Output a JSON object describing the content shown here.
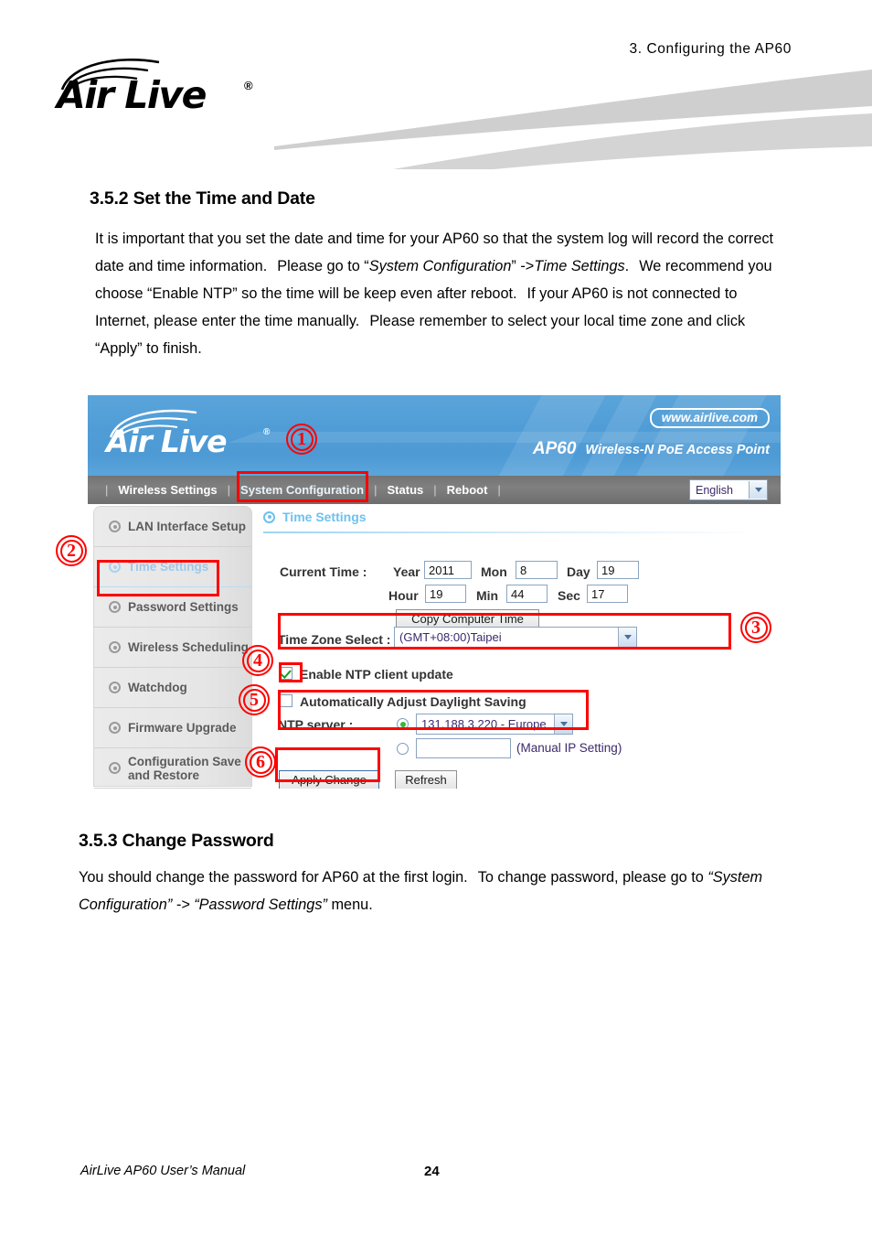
{
  "page": {
    "chapter_header": "3.  Configuring  the  AP60",
    "footer_text": "AirLive AP60 User’s Manual",
    "page_number": "24",
    "brand_logo_text": "Air Live",
    "brand_reg_mark": "®"
  },
  "section_352": {
    "title": "3.5.2 Set the Time and Date",
    "paragraph": {
      "p1": "It is important that you set the date and time for your AP60 so that the system log will record the correct date and time information.",
      "p2": "Please go to “",
      "em1": "System Configuration",
      "p3": "” ->",
      "em2": "Time Settings",
      "p4": ".",
      "p5": "We recommend you choose “Enable NTP” so the time will be keep even after reboot.",
      "p6": "If your AP60 is not connected to Internet, please enter the time manually.",
      "p7": "Please remember to select your local time zone and click “Apply” to finish."
    }
  },
  "section_353": {
    "title": "3.5.3 Change Password",
    "paragraph": {
      "p1": "You should change the password for AP60 at the first login.",
      "p2": "To change password, please go to",
      "em1": "“System Configuration” -> “Password Settings”",
      "p3": "menu."
    }
  },
  "screenshot": {
    "banner": {
      "logo_text": "Air Live",
      "reg_mark": "®",
      "url_badge": "www.airlive.com",
      "model": "AP60",
      "model_desc": "Wireless-N PoE Access Point"
    },
    "nav": {
      "items": [
        {
          "label": "Wireless Settings",
          "active": false
        },
        {
          "label": "System Configuration",
          "active": true
        },
        {
          "label": "Status",
          "active": false
        },
        {
          "label": "Reboot",
          "active": false
        }
      ],
      "language": "English"
    },
    "sidebar": {
      "items": [
        {
          "label": "LAN Interface Setup",
          "active": false
        },
        {
          "label": "Time Settings",
          "active": true
        },
        {
          "label": "Password Settings",
          "active": false
        },
        {
          "label": "Wireless Scheduling",
          "active": false
        },
        {
          "label": "Watchdog",
          "active": false
        },
        {
          "label": "Firmware Upgrade",
          "active": false
        },
        {
          "label": "Configuration Save and Restore",
          "active": false
        }
      ]
    },
    "panel": {
      "title": "Time Settings",
      "current_time_label": "Current Time :",
      "fields": {
        "year_label": "Year",
        "year_value": "2011",
        "mon_label": "Mon",
        "mon_value": "8",
        "day_label": "Day",
        "day_value": "19",
        "hour_label": "Hour",
        "hour_value": "19",
        "min_label": "Min",
        "min_value": "44",
        "sec_label": "Sec",
        "sec_value": "17"
      },
      "copy_time_button": "Copy Computer Time",
      "time_zone_label": "Time Zone Select :",
      "time_zone_value": "(GMT+08:00)Taipei",
      "enable_ntp_label": "Enable NTP client update",
      "enable_ntp_checked": true,
      "daylight_label": "Automatically Adjust Daylight Saving",
      "daylight_checked": false,
      "ntp_server_label": "NTP server :",
      "ntp_server_value": "131.188.3.220 - Europe",
      "ntp_server_selected": true,
      "manual_ip_value": "",
      "manual_ip_note": "(Manual IP Setting)",
      "manual_ip_selected": false,
      "apply_button": "Apply Change",
      "refresh_button": "Refresh"
    },
    "annotations": {
      "accent_color": "#ff0000",
      "markers": [
        {
          "number": "1"
        },
        {
          "number": "2"
        },
        {
          "number": "3"
        },
        {
          "number": "4"
        },
        {
          "number": "5"
        },
        {
          "number": "6"
        }
      ]
    }
  }
}
